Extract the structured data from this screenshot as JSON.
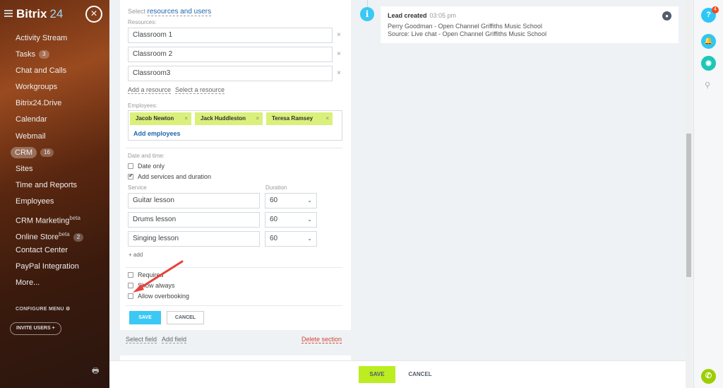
{
  "app": {
    "logo": "Bitrix",
    "logo_num": "24"
  },
  "sidebar": {
    "items": [
      {
        "label": "Activity Stream",
        "badge": null,
        "sup": null
      },
      {
        "label": "Tasks",
        "badge": "3",
        "sup": null
      },
      {
        "label": "Chat and Calls",
        "badge": null,
        "sup": null
      },
      {
        "label": "Workgroups",
        "badge": null,
        "sup": null
      },
      {
        "label": "Bitrix24.Drive",
        "badge": null,
        "sup": null
      },
      {
        "label": "Calendar",
        "badge": null,
        "sup": null
      },
      {
        "label": "Webmail",
        "badge": null,
        "sup": null
      },
      {
        "label": "CRM",
        "badge": "16",
        "sup": null,
        "active": true
      },
      {
        "label": "Sites",
        "badge": null,
        "sup": null
      },
      {
        "label": "Time and Reports",
        "badge": null,
        "sup": null
      },
      {
        "label": "Employees",
        "badge": null,
        "sup": null
      },
      {
        "label": "CRM Marketing",
        "badge": null,
        "sup": "beta"
      },
      {
        "label": "Online Store",
        "badge": "2",
        "sup": "beta"
      },
      {
        "label": "Contact Center",
        "badge": null,
        "sup": null
      },
      {
        "label": "PayPal Integration",
        "badge": null,
        "sup": null
      },
      {
        "label": "More...",
        "badge": null,
        "sup": null
      }
    ],
    "configure_menu": "CONFIGURE MENU",
    "invite_users": "INVITE USERS"
  },
  "form": {
    "select_prefix": "Select",
    "select_link": "resources and users",
    "resources_label": "Resources:",
    "resources": [
      "Classroom 1",
      "Classroom 2",
      "Classroom3"
    ],
    "add_resource": "Add a resource",
    "select_resource": "Select a resource",
    "employees_label": "Employees:",
    "employees": [
      "Jacob Newton",
      "Jack Huddleston",
      "Teresa Ramsey"
    ],
    "add_employees": "Add employees",
    "date_time_label": "Date and time:",
    "date_only": "Date only",
    "add_services": "Add services and duration",
    "service_label": "Service",
    "duration_label": "Duration",
    "services": [
      {
        "name": "Guitar lesson",
        "duration": "60"
      },
      {
        "name": "Drums lesson",
        "duration": "60"
      },
      {
        "name": "Singing lesson",
        "duration": "60"
      }
    ],
    "add": "+ add",
    "required": "Required",
    "show_always": "Show always",
    "allow_overbooking": "Allow overbooking",
    "save": "SAVE",
    "cancel": "CANCEL",
    "select_field": "Select field",
    "add_field": "Add field",
    "delete_section": "Delete section"
  },
  "timeline": {
    "title": "Lead created",
    "time": "03:05 pm",
    "line1": "Perry Goodman - Open Channel Griffiths Music School",
    "line2": "Source: Live chat - Open Channel Griffiths Music School"
  },
  "rail": {
    "help_badge": "4"
  },
  "bottom": {
    "save": "SAVE",
    "cancel": "CANCEL"
  },
  "colors": {
    "accent": "#3bc8f5",
    "save_green": "#bbed21",
    "tag": "#d9f07b",
    "delete": "#d24430"
  }
}
